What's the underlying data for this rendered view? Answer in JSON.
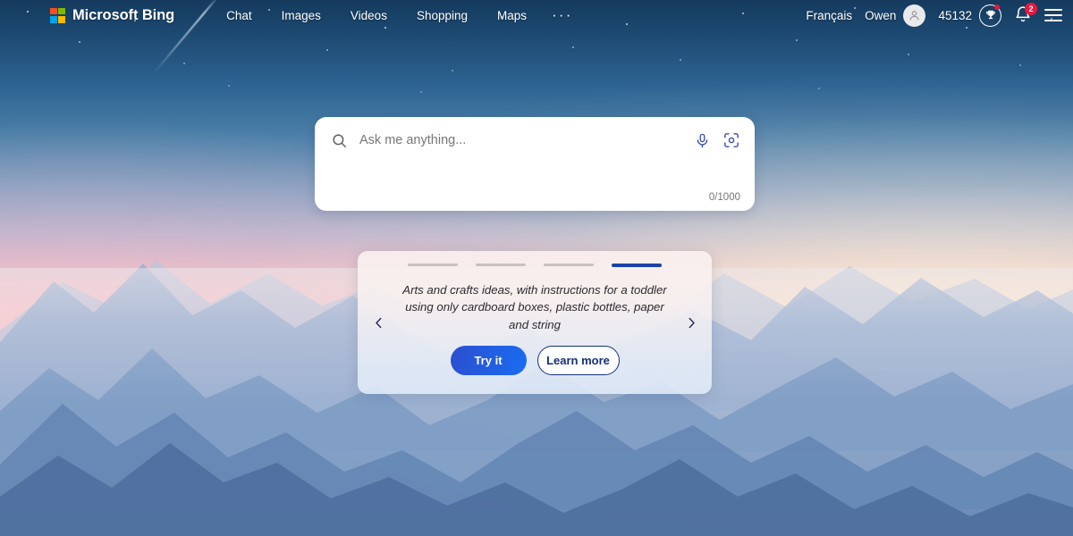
{
  "header": {
    "brand": "Microsoft Bing",
    "logo_icon": "microsoft-logo-icon",
    "nav": [
      {
        "label": "Chat",
        "icon": "chat-nav"
      },
      {
        "label": "Images",
        "icon": "images-nav"
      },
      {
        "label": "Videos",
        "icon": "videos-nav"
      },
      {
        "label": "Shopping",
        "icon": "shopping-nav"
      },
      {
        "label": "Maps",
        "icon": "maps-nav"
      }
    ],
    "more_label": "···",
    "language": "Français",
    "user_name": "Owen",
    "avatar_icon": "person-avatar-icon",
    "rewards_points": "45132",
    "rewards_icon": "trophy-rewards-icon",
    "notifications_icon": "bell-icon",
    "notifications_count": "2",
    "menu_icon": "hamburger-menu-icon"
  },
  "search": {
    "placeholder": "Ask me anything...",
    "value": "",
    "search_icon": "magnifier-search-icon",
    "mic_icon": "microphone-icon",
    "visual_search_icon": "visual-search-camera-icon",
    "counter": "0/1000"
  },
  "carousel": {
    "prev_icon": "chevron-left-icon",
    "next_icon": "chevron-right-icon",
    "indicators": [
      {
        "active": false
      },
      {
        "active": false
      },
      {
        "active": false
      },
      {
        "active": true
      }
    ],
    "active_index": 3,
    "prompt": "Arts and crafts ideas, with instructions for a toddler using only cardboard boxes, plastic bottles, paper and string",
    "primary_label": "Try it",
    "secondary_label": "Learn more"
  },
  "colors": {
    "accent_blue": "#1b43a8",
    "primary_button": "#1a6cf0",
    "badge_red": "#e8173d",
    "sky_top": "#153a5e",
    "sky_pink": "#f7cfc8"
  }
}
